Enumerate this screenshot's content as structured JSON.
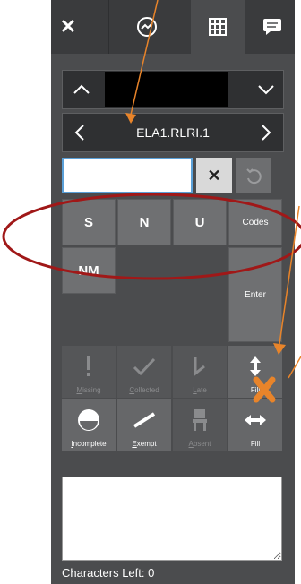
{
  "toolbar": {
    "close_icon": "close-icon",
    "chart_icon": "trend-chart-icon",
    "grid_icon": "grid-icon",
    "comment_icon": "comment-icon"
  },
  "navigator": {
    "standard_code": "ELA1.RLRI.1"
  },
  "entry": {
    "input_value": "",
    "clear_symbol": "✕"
  },
  "score_keys": [
    {
      "label": "S"
    },
    {
      "label": "N"
    },
    {
      "label": "U"
    },
    {
      "label": "NM"
    }
  ],
  "side_keys": {
    "codes": "Codes",
    "enter": "Enter"
  },
  "status_row1": [
    {
      "label": "Missing",
      "underline": "M",
      "rest": "issing",
      "enabled": false
    },
    {
      "label": "Collected",
      "underline": "C",
      "rest": "ollected",
      "enabled": false
    },
    {
      "label": "Late",
      "underline": "L",
      "rest": "ate",
      "enabled": false
    },
    {
      "label": "Fill",
      "underline": "",
      "rest": "Fill",
      "enabled": true
    }
  ],
  "status_row2": [
    {
      "label": "Incomplete",
      "underline": "I",
      "rest": "ncomplete",
      "enabled": true
    },
    {
      "label": "Exempt",
      "underline": "E",
      "rest": "xempt",
      "enabled": true
    },
    {
      "label": "Absent",
      "underline": "A",
      "rest": "bsent",
      "enabled": false
    },
    {
      "label": "Fill",
      "underline": "",
      "rest": "Fill",
      "enabled": true
    }
  ],
  "footer": {
    "characters_left": "Characters Left: 0"
  },
  "colors": {
    "annotation_orange": "#e8842a",
    "annotation_red": "#a01818"
  }
}
